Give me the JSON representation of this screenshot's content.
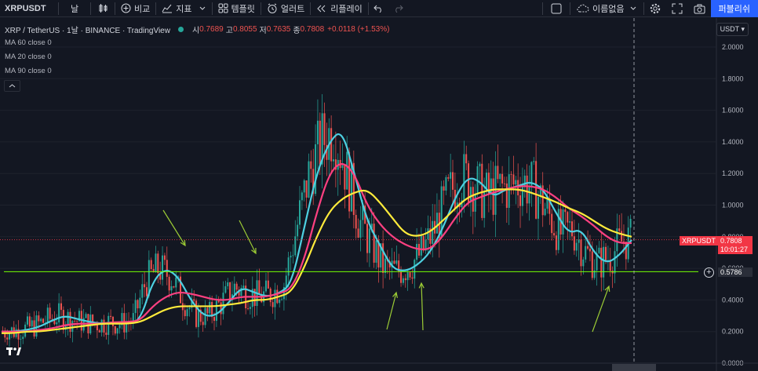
{
  "toolbar": {
    "symbol": "XRPUSDT",
    "interval": "날",
    "compare": "비교",
    "indicators": "지표",
    "templates": "템플릿",
    "alert": "얼러트",
    "replay": "리플레이",
    "layout_name": "이름없음",
    "publish": "퍼블리쉬"
  },
  "legend": {
    "title": "XRP / TetherUS · 1날 · BINANCE · TradingView",
    "open_label": "시",
    "open": "0.7689",
    "high_label": "고",
    "high": "0.8055",
    "low_label": "저",
    "low": "0.7635",
    "close_label": "종",
    "close": "0.7808",
    "change": "+0.0118 (+1.53%)"
  },
  "indicators": [
    {
      "label": "MA 60 close 0"
    },
    {
      "label": "MA 20 close 0"
    },
    {
      "label": "MA 90 close 0"
    }
  ],
  "currency": "USDT",
  "price_axis": [
    "2.0000",
    "1.8000",
    "1.6000",
    "1.4000",
    "1.2000",
    "1.0000",
    "0.8000",
    "0.6000",
    "0.4000",
    "0.2000",
    "0.0000"
  ],
  "last_price_tag": {
    "symbol": "XRPUSDT",
    "price": "0.7808",
    "countdown": "10:01:27"
  },
  "hline_price": "0.5786",
  "colors": {
    "up": "#26a69a",
    "down": "#ef5350",
    "ma20": "#4dd0e1",
    "ma60": "#ff4081",
    "ma90": "#ffeb3b",
    "hline": "#76ff03",
    "arrow": "#9ccc35"
  },
  "chart_data": {
    "type": "line",
    "ylim": [
      0,
      2.0
    ],
    "y_ticks": [
      0,
      0.2,
      0.4,
      0.6,
      0.8,
      1.0,
      1.2,
      1.4,
      1.6,
      1.8,
      2.0
    ],
    "series": [
      {
        "name": "MA 20 close 0",
        "color": "#4dd0e1",
        "values": [
          0.2,
          0.2,
          0.21,
          0.23,
          0.27,
          0.3,
          0.28,
          0.26,
          0.25,
          0.26,
          0.25,
          0.27,
          0.52,
          0.6,
          0.55,
          0.4,
          0.3,
          0.3,
          0.38,
          0.48,
          0.45,
          0.42,
          0.44,
          0.5,
          0.85,
          1.2,
          1.4,
          1.48,
          1.2,
          0.9,
          0.75,
          0.6,
          0.58,
          0.62,
          0.7,
          0.85,
          1.05,
          1.18,
          1.15,
          1.05,
          1.1,
          1.12,
          1.15,
          1.1,
          0.95,
          0.82,
          0.85,
          0.7,
          0.63,
          0.68,
          0.78
        ]
      },
      {
        "name": "MA 60 close 0",
        "color": "#ff4081",
        "values": [
          0.2,
          0.2,
          0.2,
          0.21,
          0.22,
          0.24,
          0.25,
          0.25,
          0.25,
          0.26,
          0.26,
          0.27,
          0.36,
          0.42,
          0.45,
          0.44,
          0.42,
          0.4,
          0.4,
          0.42,
          0.42,
          0.42,
          0.44,
          0.47,
          0.65,
          0.95,
          1.2,
          1.28,
          1.2,
          1.0,
          0.88,
          0.8,
          0.75,
          0.72,
          0.72,
          0.8,
          0.92,
          1.02,
          1.05,
          1.08,
          1.1,
          1.12,
          1.12,
          1.1,
          1.05,
          0.98,
          0.93,
          0.87,
          0.8,
          0.76,
          0.76
        ]
      },
      {
        "name": "MA 90 close 0",
        "color": "#ffeb3b",
        "values": [
          0.19,
          0.19,
          0.2,
          0.2,
          0.21,
          0.22,
          0.23,
          0.24,
          0.25,
          0.25,
          0.25,
          0.26,
          0.3,
          0.34,
          0.36,
          0.36,
          0.36,
          0.36,
          0.37,
          0.38,
          0.4,
          0.4,
          0.42,
          0.45,
          0.6,
          0.8,
          0.96,
          1.04,
          1.08,
          1.1,
          1.02,
          0.92,
          0.82,
          0.8,
          0.83,
          0.9,
          0.98,
          1.05,
          1.08,
          1.1,
          1.1,
          1.1,
          1.08,
          1.05,
          1.02,
          0.98,
          0.95,
          0.9,
          0.85,
          0.82,
          0.8
        ]
      }
    ]
  }
}
